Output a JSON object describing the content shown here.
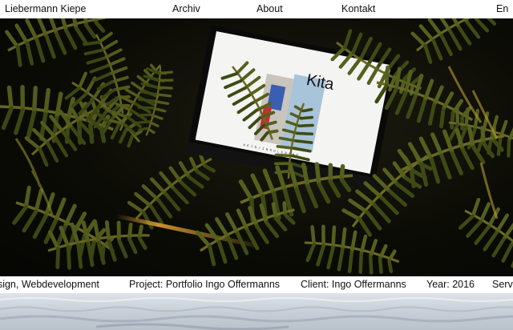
{
  "nav": {
    "brand": "Liebermann Kiepe",
    "archiv": "Archiv",
    "about": "About",
    "kontakt": "Kontakt",
    "lang": "En"
  },
  "hero": {
    "screen_title": "Kita",
    "screen_caption": "K E Y N / I N G O L E R S B E . . ."
  },
  "ticker": {
    "services": "esign, Webdevelopment",
    "project": "Project: Portfolio Ingo Offermanns",
    "client": "Client: Ingo Offermanns",
    "year": "Year: 2016",
    "next": "Servi"
  },
  "colors": {
    "text": "#111111",
    "background": "#ffffff",
    "foliage": "#4e5a1c",
    "foliage_highlight": "#b8a030",
    "light_streak": "#e0a030"
  }
}
